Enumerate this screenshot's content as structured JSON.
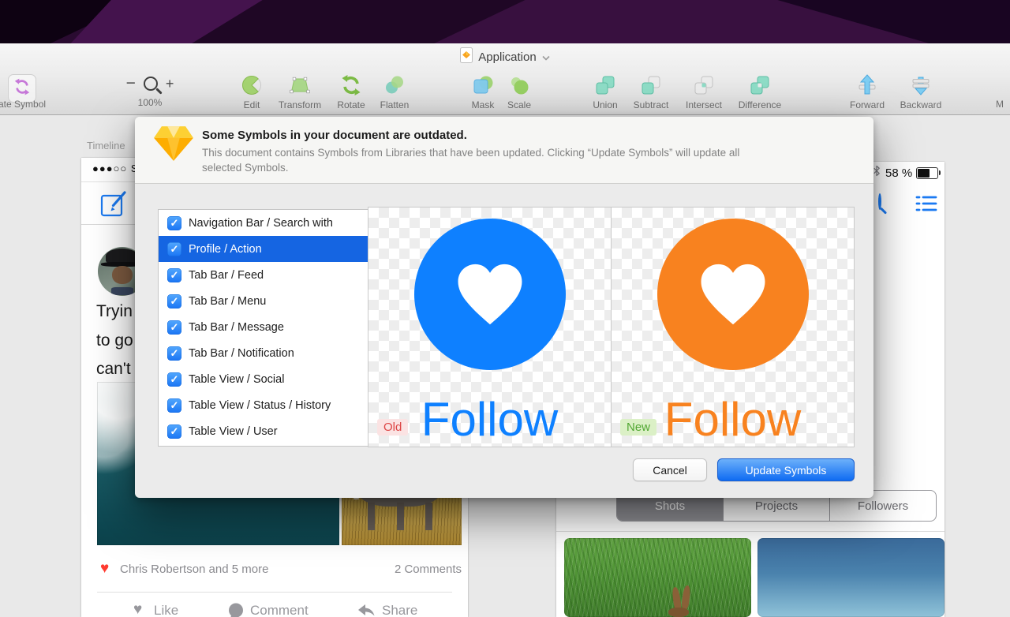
{
  "titlebar": {
    "title": "Application"
  },
  "toolbar": {
    "symbol_label": "ate Symbol",
    "zoom": {
      "minus": "−",
      "value": "100%",
      "plus": "+"
    },
    "items": [
      "Edit",
      "Transform",
      "Rotate",
      "Flatten",
      "Mask",
      "Scale",
      "Union",
      "Subtract",
      "Intersect",
      "Difference",
      "Forward",
      "Backward"
    ],
    "more_label": "M"
  },
  "dialog": {
    "title": "Some Symbols in your document are outdated.",
    "desc1": "This document contains Symbols from Libraries that have been updated. Clicking “Update Symbols” will update all",
    "desc2": "selected Symbols.",
    "symbols": [
      {
        "label": "Navigation Bar / Search with",
        "checked": true,
        "selected": false
      },
      {
        "label": "Profile / Action",
        "checked": true,
        "selected": true
      },
      {
        "label": "Tab Bar / Feed",
        "checked": true,
        "selected": false
      },
      {
        "label": "Tab Bar / Menu",
        "checked": true,
        "selected": false
      },
      {
        "label": "Tab Bar / Message",
        "checked": true,
        "selected": false
      },
      {
        "label": "Tab Bar / Notification",
        "checked": true,
        "selected": false
      },
      {
        "label": "Table View / Social",
        "checked": true,
        "selected": false
      },
      {
        "label": "Table View / Status / History",
        "checked": true,
        "selected": false
      },
      {
        "label": "Table View / User",
        "checked": true,
        "selected": false
      }
    ],
    "preview": {
      "old_badge": "Old",
      "new_badge": "New",
      "old_text": "Follow",
      "new_text": "Follow"
    },
    "cancel_label": "Cancel",
    "update_label": "Update Symbols"
  },
  "timeline": {
    "name": "Timeline",
    "status_bar": "●●●○○ S",
    "post_lines": [
      "Tryin",
      "to go",
      "can't"
    ],
    "likes_text": "Chris Robertson and 5 more",
    "comments_text": "2 Comments",
    "actions": [
      "Like",
      "Comment",
      "Share"
    ]
  },
  "profile": {
    "battery_text": "58 %",
    "tabs": [
      "Shots",
      "Projects",
      "Followers"
    ]
  },
  "colors": {
    "old_symbol_blue": "#0e80ff",
    "new_symbol_orange": "#f8821f",
    "selection_blue": "#1565e2",
    "old_badge_red": "#d44444",
    "new_badge_green": "#52a733"
  }
}
